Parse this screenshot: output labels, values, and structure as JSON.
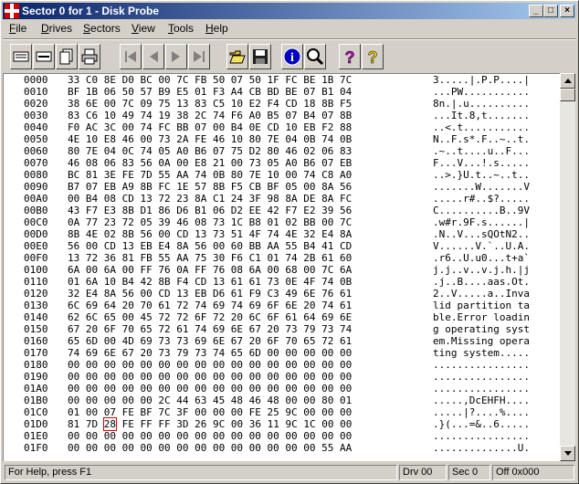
{
  "title": "Sector 0 for 1 - Disk Probe",
  "caption_buttons": {
    "minimize": "_",
    "maximize": "□",
    "close": "×"
  },
  "menu": [
    {
      "pre": "",
      "ul": "F",
      "post": "ile"
    },
    {
      "pre": "",
      "ul": "D",
      "post": "rives"
    },
    {
      "pre": "",
      "ul": "S",
      "post": "ectors"
    },
    {
      "pre": "",
      "ul": "V",
      "post": "iew"
    },
    {
      "pre": "",
      "ul": "T",
      "post": "ools"
    },
    {
      "pre": "",
      "ul": "H",
      "post": "elp"
    }
  ],
  "toolbar_icons": [
    "view-bytes-icon",
    "view-words-icon",
    "view-dwords-icon",
    "print-icon",
    "first-sector-icon",
    "previous-sector-icon",
    "next-sector-icon",
    "last-sector-icon",
    "open-folder-icon",
    "save-disk-icon",
    "info-icon",
    "find-icon",
    "help-icon",
    "context-help-icon"
  ],
  "hex_rows": [
    {
      "off": "0000",
      "hex": "33 C0 8E D0 BC 00 7C FB 50 07 50 1F FC BE 1B 7C",
      "asc": "3.....|.P.P....|"
    },
    {
      "off": "0010",
      "hex": "BF 1B 06 50 57 B9 E5 01 F3 A4 CB BD BE 07 B1 04",
      "asc": "...PW..........."
    },
    {
      "off": "0020",
      "hex": "38 6E 00 7C 09 75 13 83 C5 10 E2 F4 CD 18 8B F5",
      "asc": "8n.|.u.........."
    },
    {
      "off": "0030",
      "hex": "83 C6 10 49 74 19 38 2C 74 F6 A0 B5 07 B4 07 8B",
      "asc": "...It.8,t......."
    },
    {
      "off": "0040",
      "hex": "F0 AC 3C 00 74 FC BB 07 00 B4 0E CD 10 EB F2 88",
      "asc": "..<.t..........."
    },
    {
      "off": "0050",
      "hex": "4E 10 E8 46 00 73 2A FE 46 10 80 7E 04 0B 74 0B",
      "asc": "N..F.s*.F..~..t."
    },
    {
      "off": "0060",
      "hex": "80 7E 04 0C 74 05 A0 B6 07 75 D2 80 46 02 06 83",
      "asc": ".~..t....u..F..."
    },
    {
      "off": "0070",
      "hex": "46 08 06 83 56 0A 00 E8 21 00 73 05 A0 B6 07 EB",
      "asc": "F...V...!.s....."
    },
    {
      "off": "0080",
      "hex": "BC 81 3E FE 7D 55 AA 74 0B 80 7E 10 00 74 C8 A0",
      "asc": "..>.}U.t..~..t.."
    },
    {
      "off": "0090",
      "hex": "B7 07 EB A9 8B FC 1E 57 8B F5 CB BF 05 00 8A 56",
      "asc": ".......W.......V"
    },
    {
      "off": "00A0",
      "hex": "00 B4 08 CD 13 72 23 8A C1 24 3F 98 8A DE 8A FC",
      "asc": ".....r#..$?....."
    },
    {
      "off": "00B0",
      "hex": "43 F7 E3 8B D1 86 D6 B1 06 D2 EE 42 F7 E2 39 56",
      "asc": "C..........B..9V"
    },
    {
      "off": "00C0",
      "hex": "0A 77 23 72 05 39 46 08 73 1C B8 01 02 BB 00 7C",
      "asc": ".w#r.9F.s......|"
    },
    {
      "off": "00D0",
      "hex": "8B 4E 02 8B 56 00 CD 13 73 51 4F 74 4E 32 E4 8A",
      "asc": ".N..V...sQOtN2.."
    },
    {
      "off": "00E0",
      "hex": "56 00 CD 13 EB E4 8A 56 00 60 BB AA 55 B4 41 CD",
      "asc": "V......V.`..U.A."
    },
    {
      "off": "00F0",
      "hex": "13 72 36 81 FB 55 AA 75 30 F6 C1 01 74 2B 61 60",
      "asc": ".r6..U.u0...t+a`"
    },
    {
      "off": "0100",
      "hex": "6A 00 6A 00 FF 76 0A FF 76 08 6A 00 68 00 7C 6A",
      "asc": "j.j..v..v.j.h.|j"
    },
    {
      "off": "0110",
      "hex": "01 6A 10 B4 42 8B F4 CD 13 61 61 73 0E 4F 74 0B",
      "asc": ".j..B....aas.Ot."
    },
    {
      "off": "0120",
      "hex": "32 E4 8A 56 00 CD 13 EB D6 61 F9 C3 49 6E 76 61",
      "asc": "2..V.....a..Inva"
    },
    {
      "off": "0130",
      "hex": "6C 69 64 20 70 61 72 74 69 74 69 6F 6E 20 74 61",
      "asc": "lid partition ta"
    },
    {
      "off": "0140",
      "hex": "62 6C 65 00 45 72 72 6F 72 20 6C 6F 61 64 69 6E",
      "asc": "ble.Error loadin"
    },
    {
      "off": "0150",
      "hex": "67 20 6F 70 65 72 61 74 69 6E 67 20 73 79 73 74",
      "asc": "g operating syst"
    },
    {
      "off": "0160",
      "hex": "65 6D 00 4D 69 73 73 69 6E 67 20 6F 70 65 72 61",
      "asc": "em.Missing opera"
    },
    {
      "off": "0170",
      "hex": "74 69 6E 67 20 73 79 73 74 65 6D 00 00 00 00 00",
      "asc": "ting system....."
    },
    {
      "off": "0180",
      "hex": "00 00 00 00 00 00 00 00 00 00 00 00 00 00 00 00",
      "asc": "................"
    },
    {
      "off": "0190",
      "hex": "00 00 00 00 00 00 00 00 00 00 00 00 00 00 00 00",
      "asc": "................"
    },
    {
      "off": "01A0",
      "hex": "00 00 00 00 00 00 00 00 00 00 00 00 00 00 00 00",
      "asc": "................"
    },
    {
      "off": "01B0",
      "hex": "00 00 00 00 00 2C 44 63 45 48 46 48 00 00 80 01",
      "asc": ".....,DcEHFH...."
    },
    {
      "off": "01C0",
      "hex": "01 00 07 FE BF 7C 3F 00 00 00 FE 25 9C 00 00 00",
      "asc": ".....|?....%...."
    },
    {
      "off": "01D0",
      "hex": "81 7D 28 FE FF FF 3D 26 9C 00 36 11 9C 1C 00 00",
      "asc": ".}(...=&..6....."
    },
    {
      "off": "01E0",
      "hex": "00 00 00 00 00 00 00 00 00 00 00 00 00 00 00 00",
      "asc": "................"
    },
    {
      "off": "01F0",
      "hex": "00 00 00 00 00 00 00 00 00 00 00 00 00 00 55 AA",
      "asc": "..............U."
    }
  ],
  "selected_byte": {
    "row": "01D0",
    "index": 2,
    "value": "28"
  },
  "status": {
    "help": "For Help, press F1",
    "drive": "Drv 00",
    "sector": "Sec 0",
    "offset": "Off 0x000"
  },
  "colors": {
    "title_start": "#0a246a",
    "title_end": "#a6caf0",
    "face": "#d4d0c8",
    "highlight": "#e00000"
  }
}
